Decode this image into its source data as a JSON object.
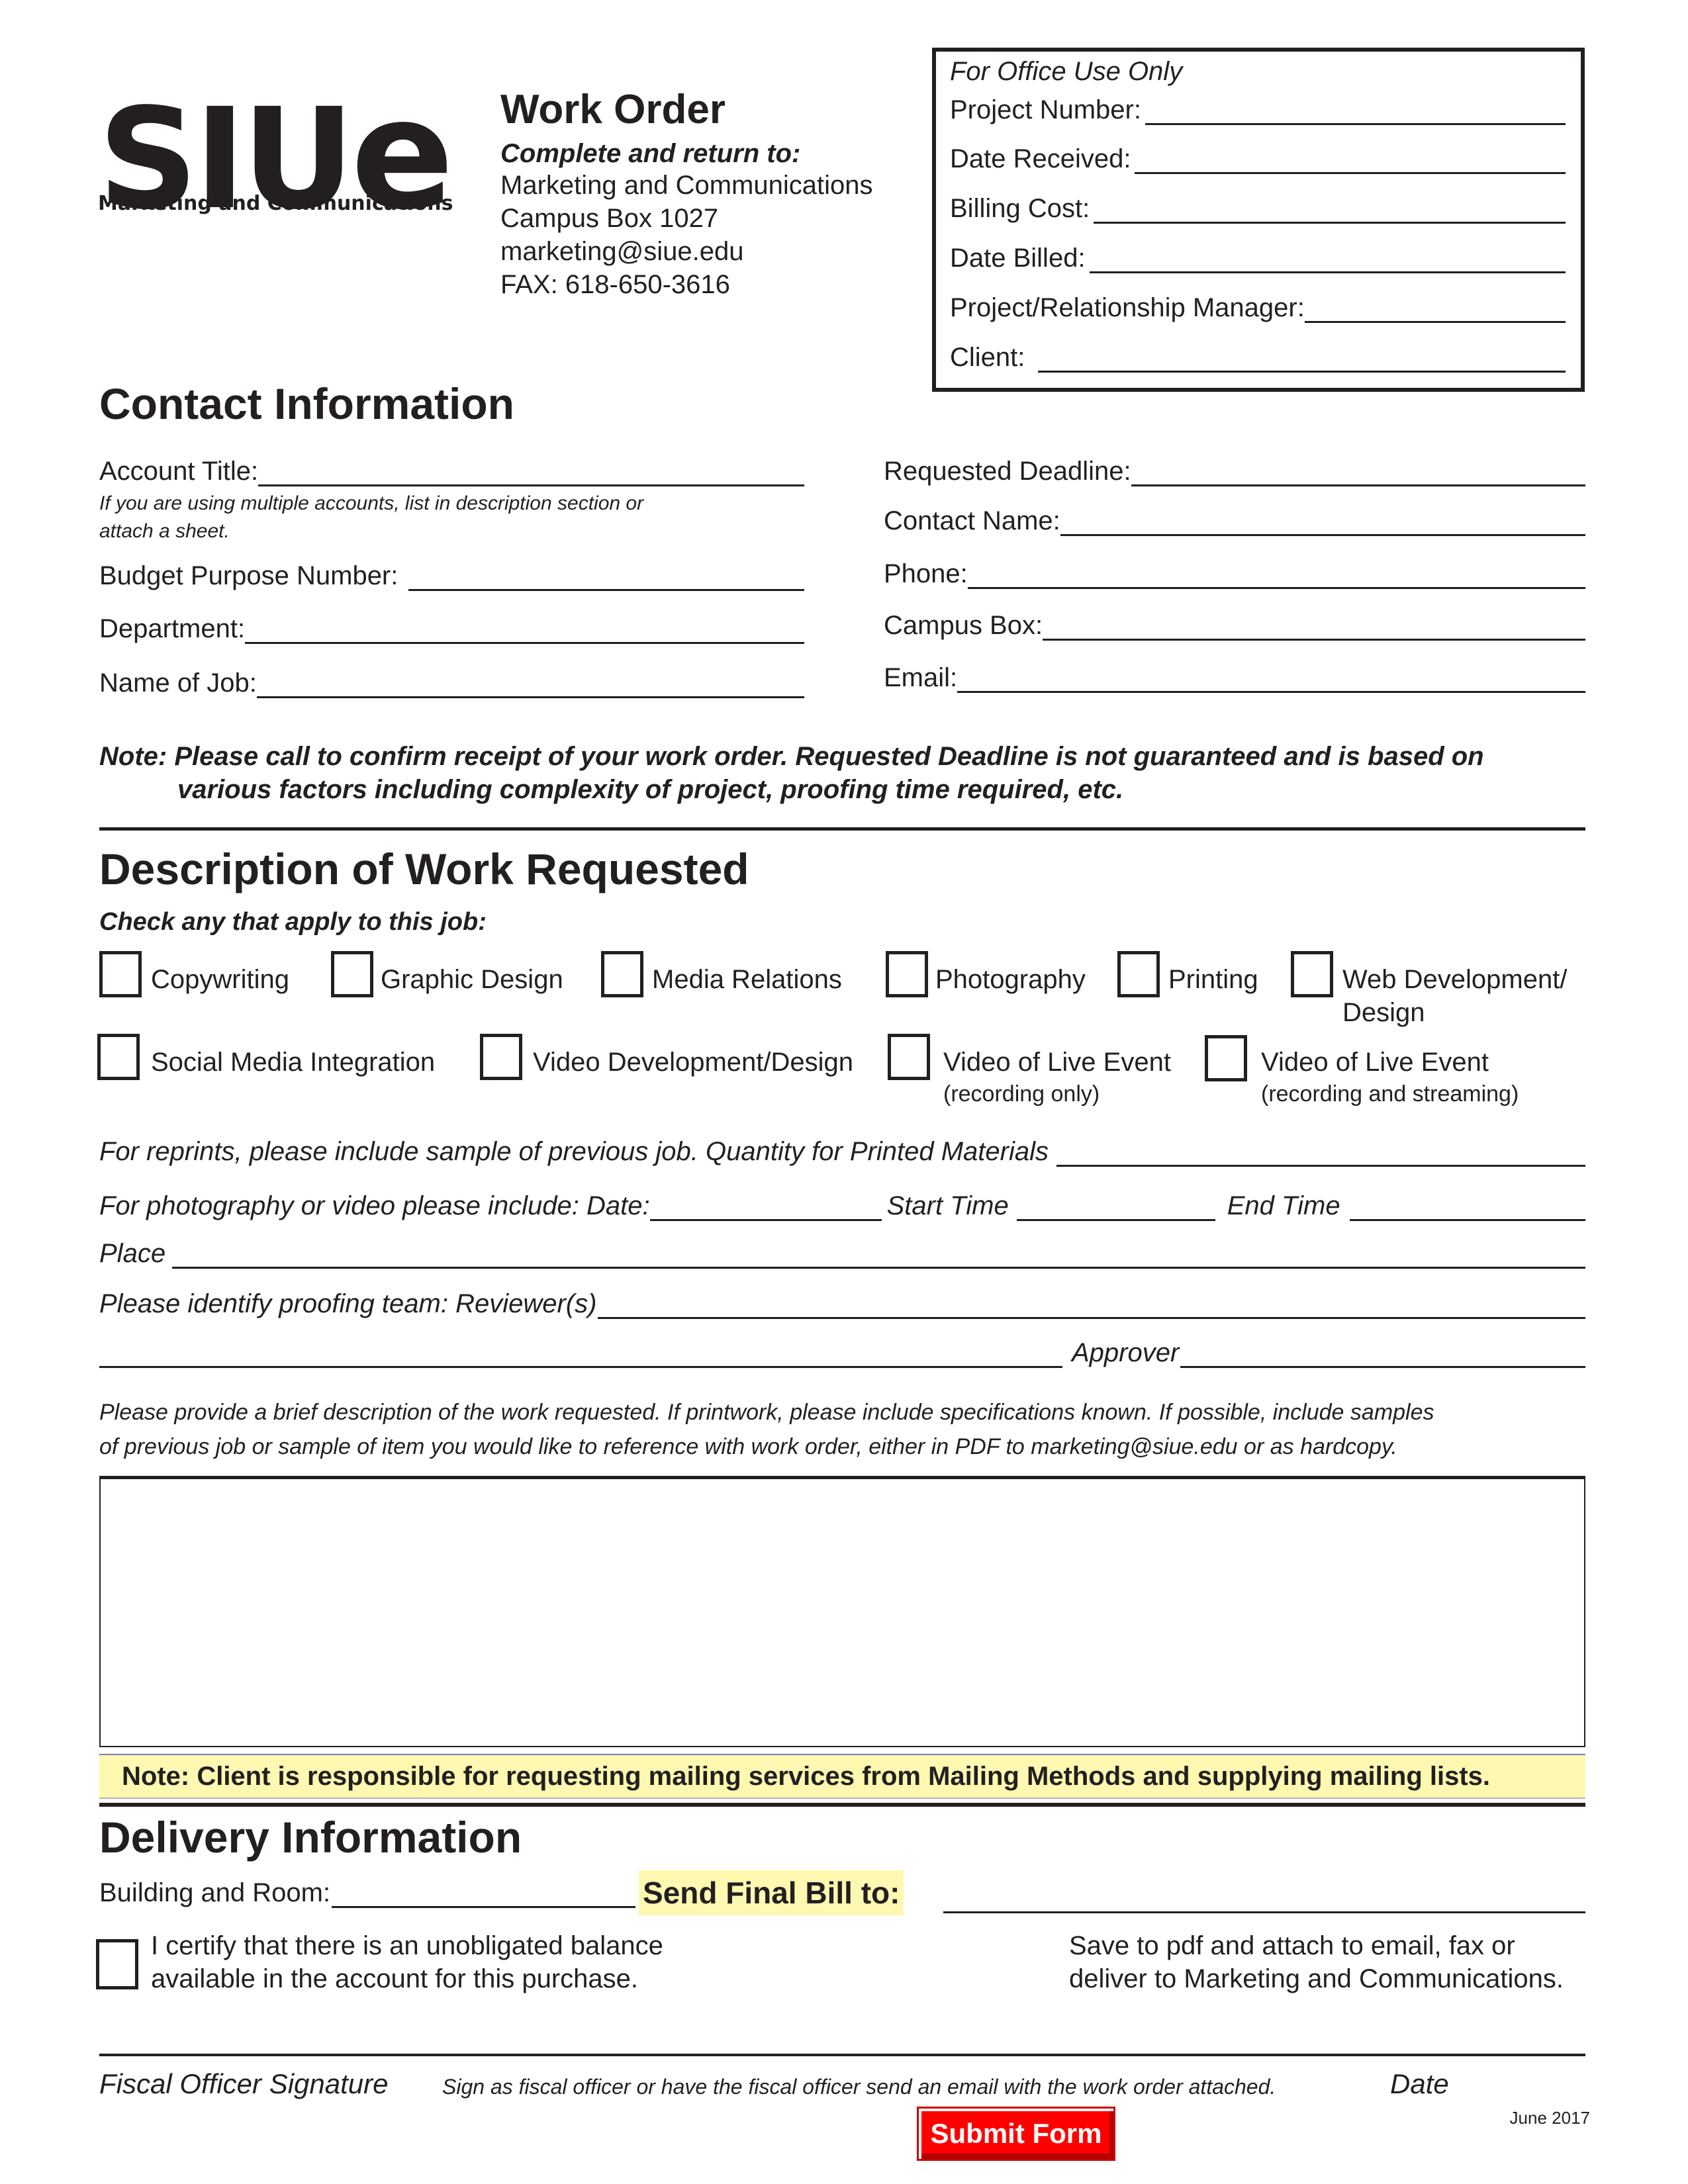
{
  "logo": {
    "mark": "SIU",
    "mark_e": "e",
    "subtitle": "Marketing and Communications"
  },
  "header": {
    "title": "Work Order",
    "return_label": "Complete and return to:",
    "address_lines": [
      "Marketing and Communications",
      "Campus Box 1027",
      "marketing@siue.edu",
      "FAX: 618-650-3616"
    ]
  },
  "office_use": {
    "title": "For Office Use Only",
    "fields": [
      {
        "label": "Project Number:",
        "value": ""
      },
      {
        "label": "Date Received:",
        "value": ""
      },
      {
        "label": "Billing Cost:",
        "value": ""
      },
      {
        "label": "Date Billed:",
        "value": ""
      },
      {
        "label": "Project/Relationship Manager:",
        "value": ""
      },
      {
        "label": "Client:",
        "value": ""
      }
    ]
  },
  "contact": {
    "heading": "Contact Information",
    "left_fields": [
      {
        "label": "Account Title:",
        "value": ""
      },
      {
        "label": "Budget Purpose Number:",
        "value": ""
      },
      {
        "label": "Department:",
        "value": ""
      },
      {
        "label": "Name of Job:",
        "value": ""
      }
    ],
    "account_hint_line1": "If you are using multiple accounts, list in description section or",
    "account_hint_line2": "attach a sheet.",
    "right_fields": [
      {
        "label": "Requested Deadline:",
        "value": ""
      },
      {
        "label": "Contact Name:",
        "value": ""
      },
      {
        "label": "Phone:",
        "value": ""
      },
      {
        "label": "Campus Box:",
        "value": ""
      },
      {
        "label": "Email:",
        "value": ""
      }
    ],
    "note_line1": "Note: Please call to confirm receipt of your work order. Requested Deadline is not guaranteed and is based on",
    "note_line2": "various factors including complexity of project, proofing time required, etc."
  },
  "description": {
    "heading": "Description of Work Requested",
    "check_prompt": "Check any that apply to this job:",
    "services": [
      {
        "label": "Copywriting",
        "checked": false
      },
      {
        "label": "Graphic Design",
        "checked": false
      },
      {
        "label": "Media Relations",
        "checked": false
      },
      {
        "label": "Photography",
        "checked": false
      },
      {
        "label": "Printing",
        "checked": false
      },
      {
        "label": "Web Development/",
        "label2": "Design",
        "checked": false
      },
      {
        "label": "Social Media Integration",
        "checked": false
      },
      {
        "label": "Video Development/Design",
        "checked": false
      },
      {
        "label": "Video of Live Event",
        "sublabel": "(recording only)",
        "checked": false
      },
      {
        "label": "Video of Live Event",
        "sublabel": "(recording and streaming)",
        "checked": false
      }
    ],
    "reprints_label": "For reprints, please include sample of previous job. Quantity for Printed Materials",
    "photo_label": "For photography or video please include:  Date:",
    "start_time_label": "Start Time",
    "end_time_label": "End Time",
    "place_label": "Place",
    "reviewer_label": "Please identify proofing team: Reviewer(s)",
    "approver_label": "Approver",
    "instructions_line1": "Please provide a brief description of the work requested. If printwork, please include specifications known. If possible, include samples",
    "instructions_line2": "of previous job or sample of item you would like to reference with work order, either in PDF to marketing@siue.edu or as hardcopy.",
    "description_value": "",
    "mailing_note": "Note: Client is responsible for requesting mailing services from Mailing Methods and supplying mailing lists."
  },
  "delivery": {
    "heading": "Delivery Information",
    "building_label": "Building and Room:",
    "send_bill_label": "Send Final Bill to:",
    "certify_line1": "I certify that there is an unobligated balance",
    "certify_line2": "available in the account for this purchase.",
    "save_line1": "Save to pdf and attach to email, fax or",
    "save_line2": "deliver to Marketing and Communications.",
    "signature_label": "Fiscal Officer Signature",
    "signature_hint": "Sign as fiscal officer or have the fiscal officer send an email with the work order attached.",
    "date_label": "Date",
    "revision": "June 2017",
    "submit_label": "Submit Form"
  },
  "colors": {
    "highlight": "#fff8b0",
    "submit": "#ff0000",
    "text": "#231f20"
  }
}
